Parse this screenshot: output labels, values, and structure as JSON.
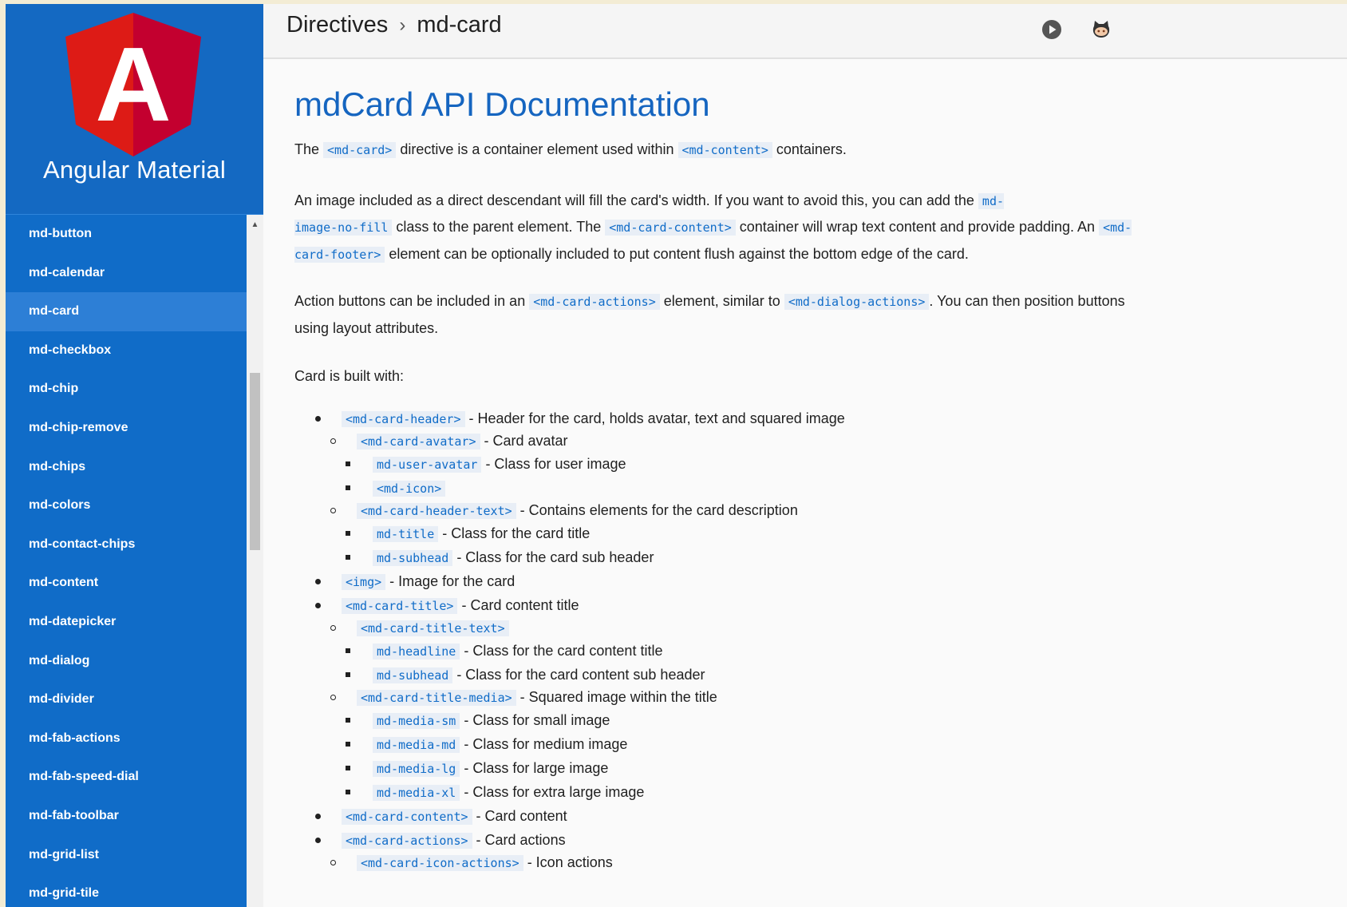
{
  "brand": {
    "name": "Angular Material",
    "logo_letter": "A",
    "colors": {
      "shield_left": "#dd1b16",
      "shield_right": "#c3002f",
      "sidebar": "#106cc8"
    }
  },
  "sidebar": {
    "items": [
      {
        "label": "md-button",
        "active": false
      },
      {
        "label": "md-calendar",
        "active": false
      },
      {
        "label": "md-card",
        "active": true
      },
      {
        "label": "md-checkbox",
        "active": false
      },
      {
        "label": "md-chip",
        "active": false
      },
      {
        "label": "md-chip-remove",
        "active": false
      },
      {
        "label": "md-chips",
        "active": false
      },
      {
        "label": "md-colors",
        "active": false
      },
      {
        "label": "md-contact-chips",
        "active": false
      },
      {
        "label": "md-content",
        "active": false
      },
      {
        "label": "md-datepicker",
        "active": false
      },
      {
        "label": "md-dialog",
        "active": false
      },
      {
        "label": "md-divider",
        "active": false
      },
      {
        "label": "md-fab-actions",
        "active": false
      },
      {
        "label": "md-fab-speed-dial",
        "active": false
      },
      {
        "label": "md-fab-toolbar",
        "active": false
      },
      {
        "label": "md-grid-list",
        "active": false
      },
      {
        "label": "md-grid-tile",
        "active": false
      }
    ]
  },
  "topbar": {
    "crumb_section": "Directives",
    "crumb_separator": "›",
    "crumb_page": "md-card",
    "icons": [
      "play-circle-icon",
      "github-icon"
    ]
  },
  "doc": {
    "title": "mdCard API Documentation",
    "p1": {
      "t1": "The ",
      "c1": "<md-card>",
      "t2": " directive is a container element used within ",
      "c2": "<md-content>",
      "t3": " containers."
    },
    "p2": {
      "t1": "An image included as a direct descendant will fill the card's width. If you want to avoid this, you can add the ",
      "c1a": "md-",
      "c1b": "image-no-fill",
      "t2": " class to the parent element. The ",
      "c2": "<md-card-content>",
      "t3": " container will wrap text content and provide padding. An ",
      "c3": "<md-card-footer>",
      "t4": " element can be optionally included to put content flush against the bottom edge of the card."
    },
    "p3": {
      "t1": "Action buttons can be included in an ",
      "c1": "<md-card-actions>",
      "t2": " element, similar to ",
      "c2": "<md-dialog-actions>",
      "t3": ". You can then position buttons using layout attributes."
    },
    "p4": "Card is built with:",
    "list": [
      {
        "level": 1,
        "code": "<md-card-header>",
        "desc": " - Header for the card, holds avatar, text and squared image"
      },
      {
        "level": 2,
        "code": "<md-card-avatar>",
        "desc": " - Card avatar"
      },
      {
        "level": 3,
        "code": "md-user-avatar",
        "desc": " - Class for user image"
      },
      {
        "level": 3,
        "code": "<md-icon>",
        "desc": ""
      },
      {
        "level": 2,
        "code": "<md-card-header-text>",
        "desc": " - Contains elements for the card description"
      },
      {
        "level": 3,
        "code": "md-title",
        "desc": " - Class for the card title"
      },
      {
        "level": 3,
        "code": "md-subhead",
        "desc": " - Class for the card sub header"
      },
      {
        "level": 1,
        "code": "<img>",
        "desc": " - Image for the card"
      },
      {
        "level": 1,
        "code": "<md-card-title>",
        "desc": " - Card content title"
      },
      {
        "level": 2,
        "code": "<md-card-title-text>",
        "desc": ""
      },
      {
        "level": 3,
        "code": "md-headline",
        "desc": " - Class for the card content title"
      },
      {
        "level": 3,
        "code": "md-subhead",
        "desc": " - Class for the card content sub header"
      },
      {
        "level": 2,
        "code": "<md-card-title-media>",
        "desc": " - Squared image within the title"
      },
      {
        "level": 3,
        "code": "md-media-sm",
        "desc": " - Class for small image"
      },
      {
        "level": 3,
        "code": "md-media-md",
        "desc": " - Class for medium image"
      },
      {
        "level": 3,
        "code": "md-media-lg",
        "desc": " - Class for large image"
      },
      {
        "level": 3,
        "code": "md-media-xl",
        "desc": " - Class for extra large image"
      },
      {
        "level": 1,
        "code": "<md-card-content>",
        "desc": " - Card content"
      },
      {
        "level": 1,
        "code": "<md-card-actions>",
        "desc": " - Card actions"
      },
      {
        "level": 2,
        "code": "<md-card-icon-actions>",
        "desc": " - Icon actions"
      }
    ]
  }
}
